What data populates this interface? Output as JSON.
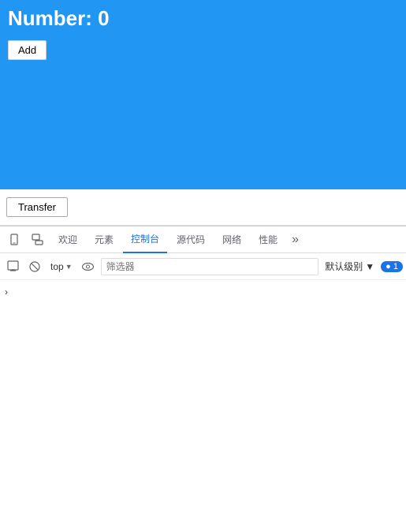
{
  "app": {
    "number_label": "Number: 0",
    "add_button": "Add",
    "transfer_button": "Transfer"
  },
  "devtools": {
    "tabs": [
      {
        "label": "欢迎",
        "active": false
      },
      {
        "label": "元素",
        "active": false
      },
      {
        "label": "控制台",
        "active": true
      },
      {
        "label": "源代码",
        "active": false
      },
      {
        "label": "网络",
        "active": false
      },
      {
        "label": "性能",
        "active": false
      }
    ],
    "toolbar": {
      "top_label": "top",
      "filter_placeholder": "筛选器",
      "level_label": "默认级别",
      "badge_count": "1"
    },
    "console": {
      "chevron": "›"
    }
  }
}
